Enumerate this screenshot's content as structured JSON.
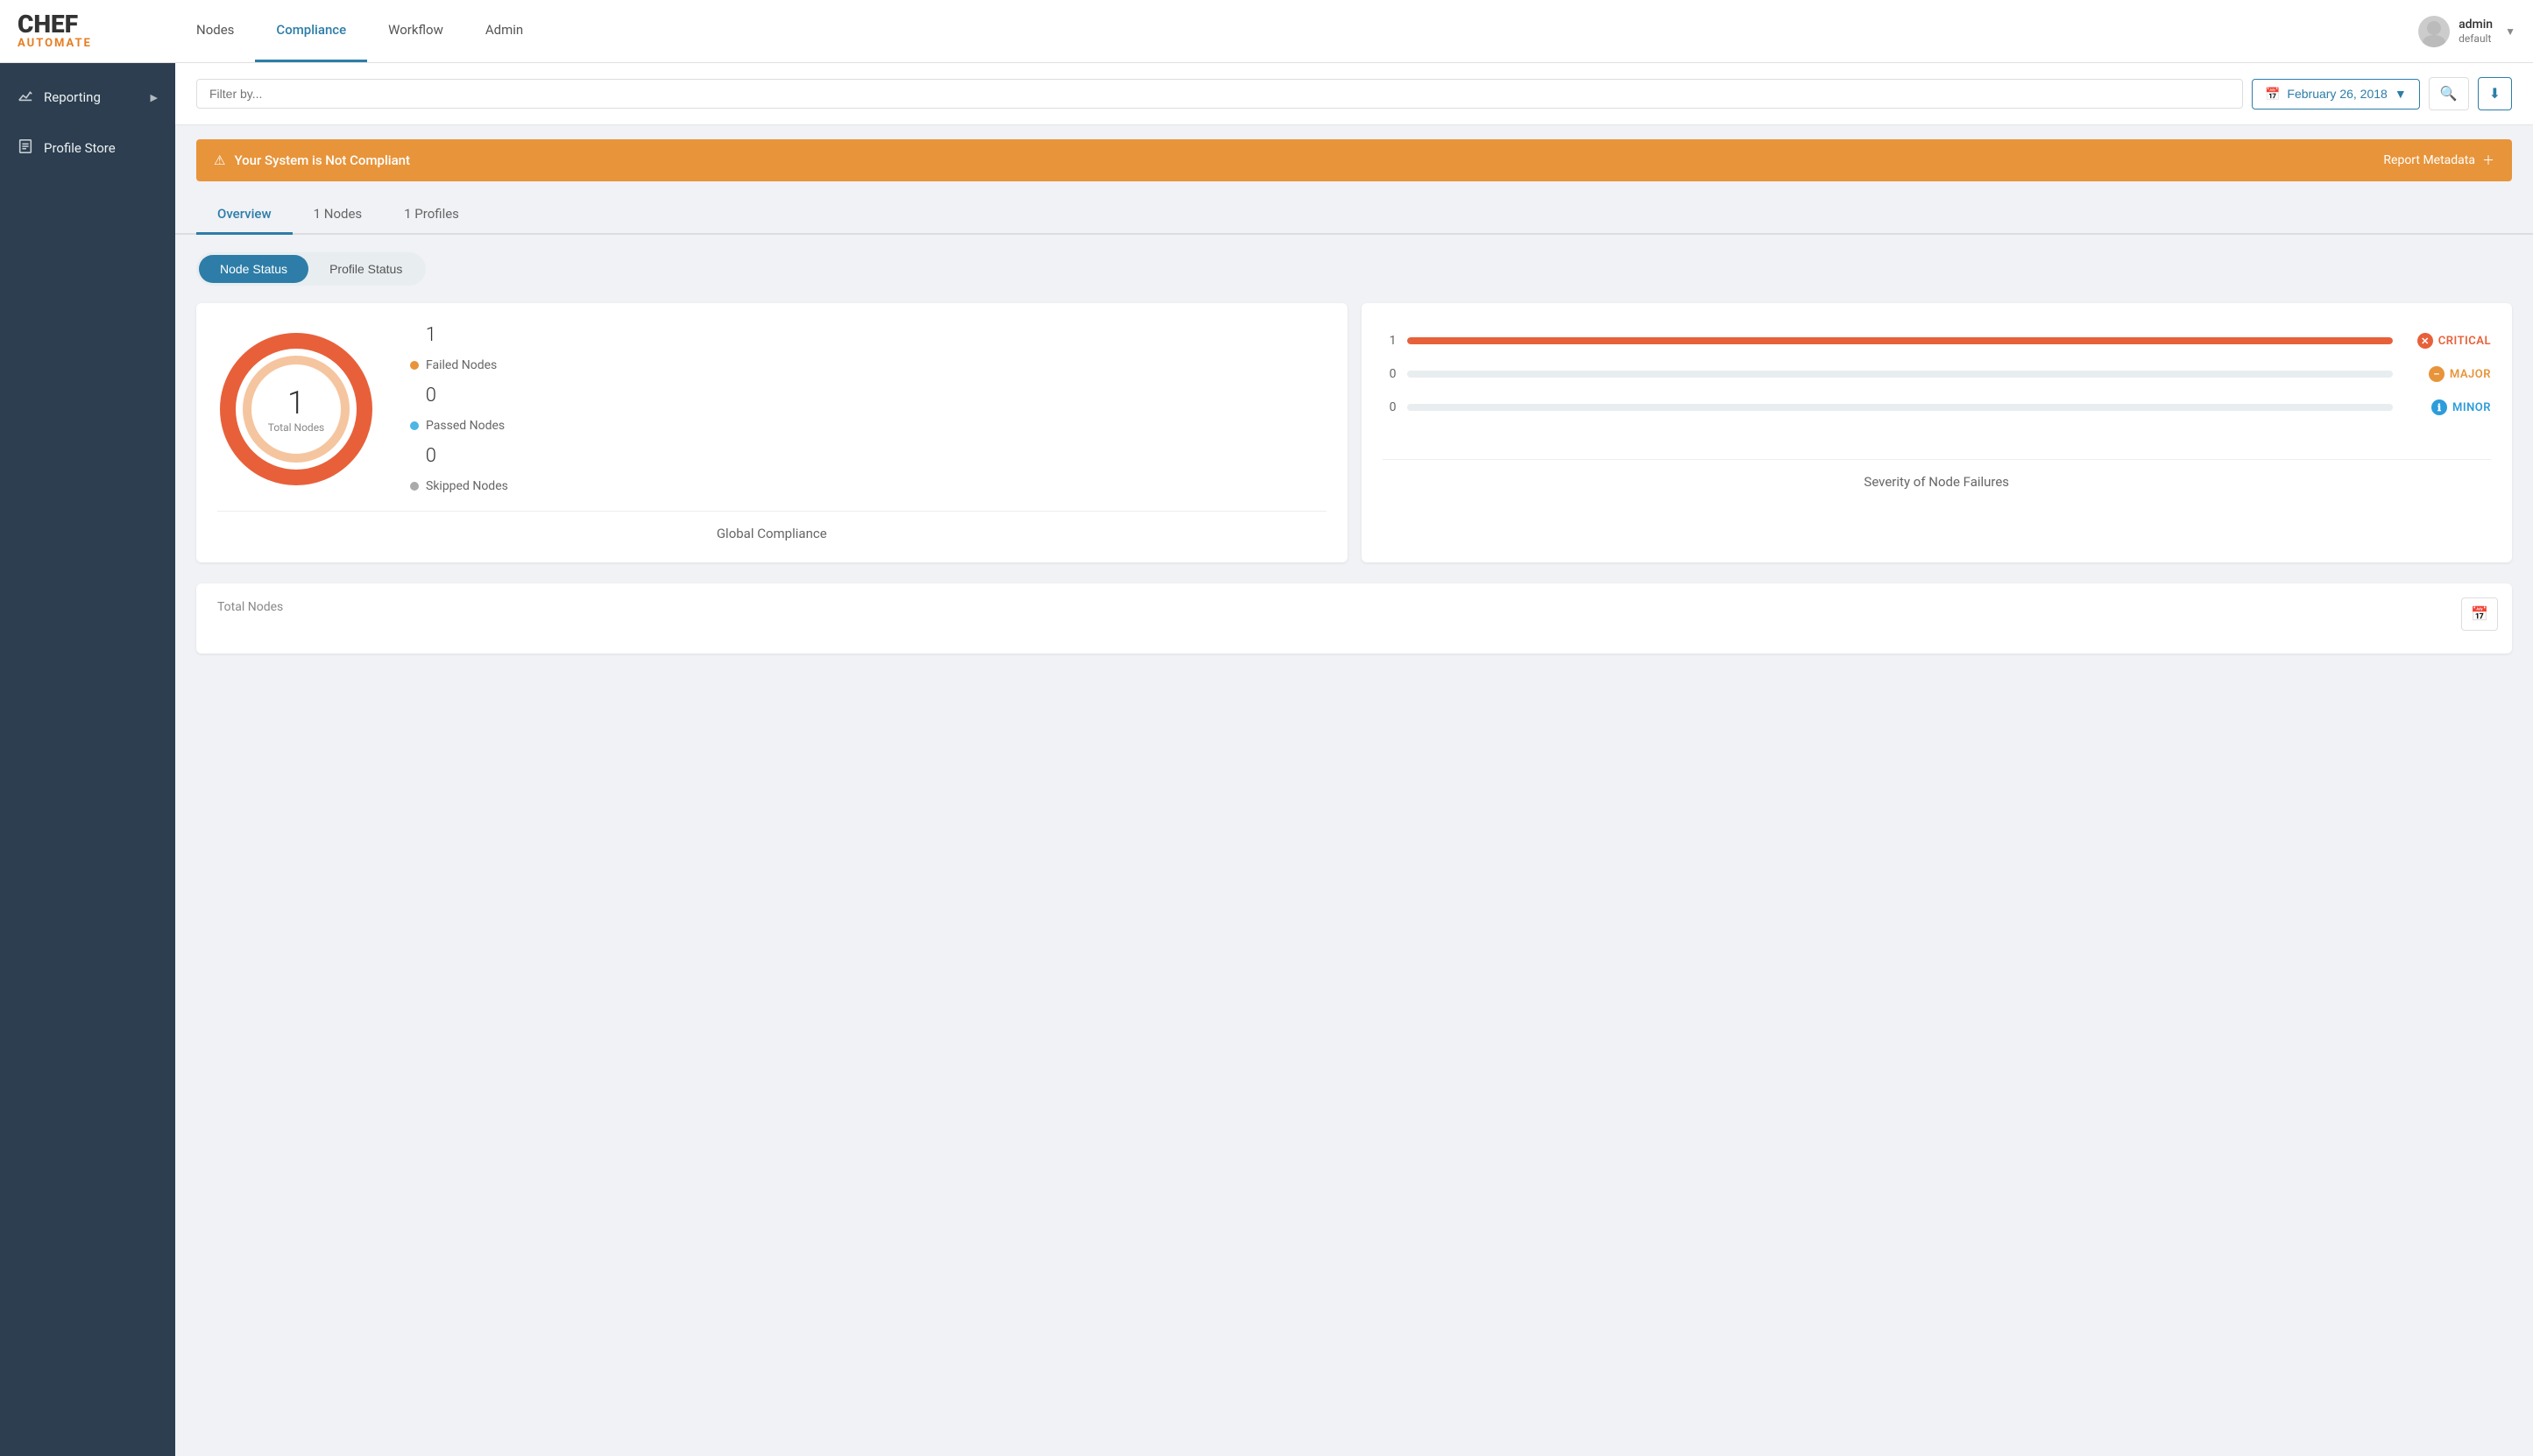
{
  "app": {
    "name": "CHEF",
    "subtitle": "AUTOMATE"
  },
  "nav": {
    "links": [
      {
        "id": "nodes",
        "label": "Nodes",
        "active": false
      },
      {
        "id": "compliance",
        "label": "Compliance",
        "active": true
      },
      {
        "id": "workflow",
        "label": "Workflow",
        "active": false
      },
      {
        "id": "admin",
        "label": "Admin",
        "active": false
      }
    ]
  },
  "user": {
    "name": "admin",
    "role": "default"
  },
  "sidebar": {
    "items": [
      {
        "id": "reporting",
        "label": "Reporting",
        "icon": "📊",
        "hasArrow": true
      },
      {
        "id": "profile-store",
        "label": "Profile Store",
        "icon": "📄",
        "hasArrow": false
      }
    ]
  },
  "filter": {
    "placeholder": "Filter by...",
    "date": "February 26, 2018"
  },
  "alert": {
    "message": "Your System is Not Compliant",
    "action": "Report Metadata"
  },
  "tabs": [
    {
      "id": "overview",
      "label": "Overview",
      "active": true
    },
    {
      "id": "nodes",
      "label": "1 Nodes",
      "active": false
    },
    {
      "id": "profiles",
      "label": "1 Profiles",
      "active": false
    }
  ],
  "toggles": [
    {
      "id": "node-status",
      "label": "Node Status",
      "active": true
    },
    {
      "id": "profile-status",
      "label": "Profile Status",
      "active": false
    }
  ],
  "donut": {
    "total": "1",
    "total_label": "Total Nodes",
    "stats": [
      {
        "count": "1",
        "label": "Failed Nodes",
        "color": "#e8943a"
      },
      {
        "count": "0",
        "label": "Passed Nodes",
        "color": "#4db6e4"
      },
      {
        "count": "0",
        "label": "Skipped Nodes",
        "color": "#aaa"
      }
    ]
  },
  "global_compliance_label": "Global Compliance",
  "severity": {
    "title": "Severity of Node Failures",
    "items": [
      {
        "id": "critical",
        "label": "CRITICAL",
        "count": "1",
        "fill_pct": 100
      },
      {
        "id": "major",
        "label": "MAJOR",
        "count": "0",
        "fill_pct": 0
      },
      {
        "id": "minor",
        "label": "MINOR",
        "count": "0",
        "fill_pct": 0
      }
    ]
  },
  "bottom_card": {
    "label": "Total Nodes"
  }
}
